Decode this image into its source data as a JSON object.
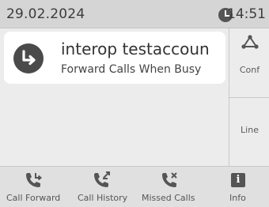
{
  "status": {
    "date": "29.02.2024",
    "time": "14:51"
  },
  "call_card": {
    "name": "interop testaccoun",
    "subtitle": "Forward Calls When Busy"
  },
  "right_softkeys": [
    {
      "label": "Conf",
      "icon": "conference-icon"
    },
    {
      "label": "Line"
    }
  ],
  "bottom_softkeys": [
    {
      "label": "Call Forward",
      "icon": "call-forward-icon"
    },
    {
      "label": "Call History",
      "icon": "call-history-icon"
    },
    {
      "label": "Missed Calls",
      "icon": "missed-calls-icon"
    },
    {
      "label": "Info",
      "icon": "info-icon"
    }
  ],
  "colors": {
    "background": "#ececec",
    "statusbar": "#d5d5d5",
    "card": "#ffffff",
    "icon": "#555555"
  }
}
